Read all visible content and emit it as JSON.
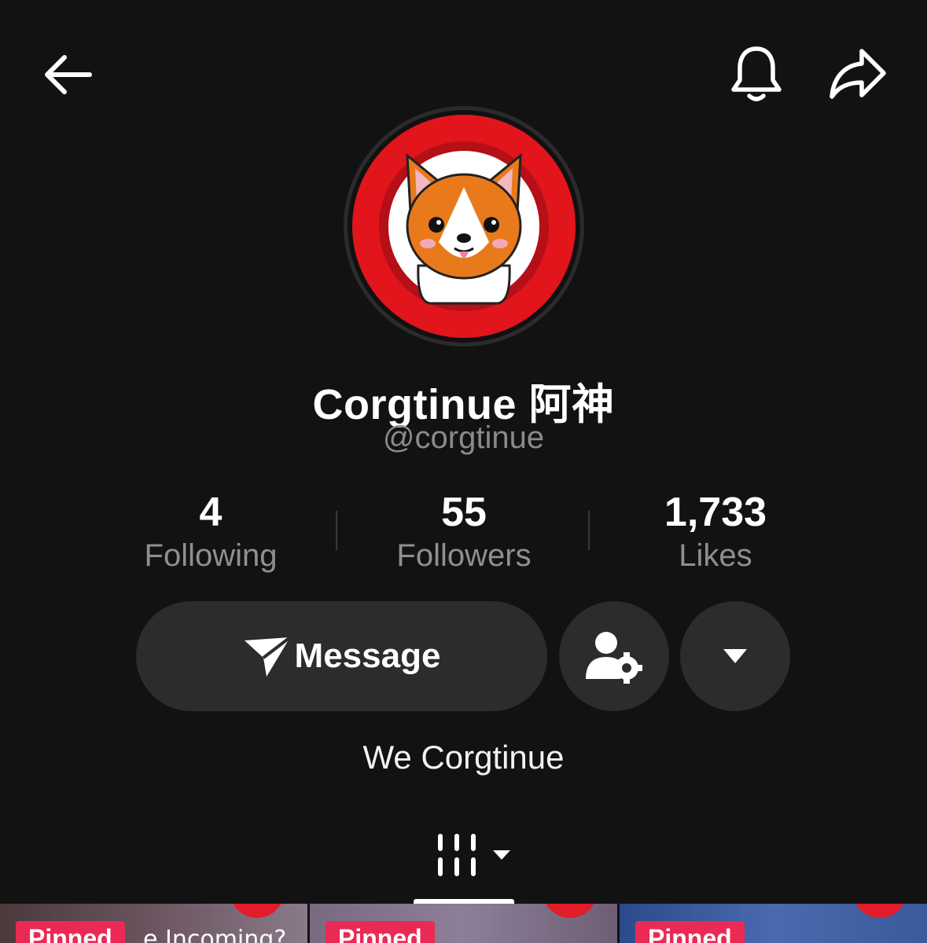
{
  "header": {
    "back_icon": "arrow-left-icon",
    "notification_icon": "bell-icon",
    "share_icon": "share-arrow-icon"
  },
  "profile": {
    "avatar": "corgi-logo-avatar",
    "display_name": "Corgtinue 阿神",
    "handle": "@corgtinue",
    "bio": "We Corgtinue"
  },
  "stats": {
    "following": {
      "value": "4",
      "label": "Following"
    },
    "followers": {
      "value": "55",
      "label": "Followers"
    },
    "likes": {
      "value": "1,733",
      "label": "Likes"
    }
  },
  "actions": {
    "message_label": "Message",
    "message_icon": "paper-plane-icon",
    "profile_settings_icon": "person-gear-icon",
    "more_icon": "caret-down-icon"
  },
  "tabs": {
    "videos_icon": "grid-columns-icon",
    "videos_dropdown_icon": "caret-down-icon"
  },
  "videos": [
    {
      "badge": "Pinned",
      "caption": "e Incoming?"
    },
    {
      "badge": "Pinned",
      "caption": ""
    },
    {
      "badge": "Pinned",
      "caption": ""
    }
  ],
  "colors": {
    "background": "#121212",
    "button_bg": "#2c2c2c",
    "pinned_badge": "#ea2a55",
    "secondary_text": "#8a8a8a"
  }
}
